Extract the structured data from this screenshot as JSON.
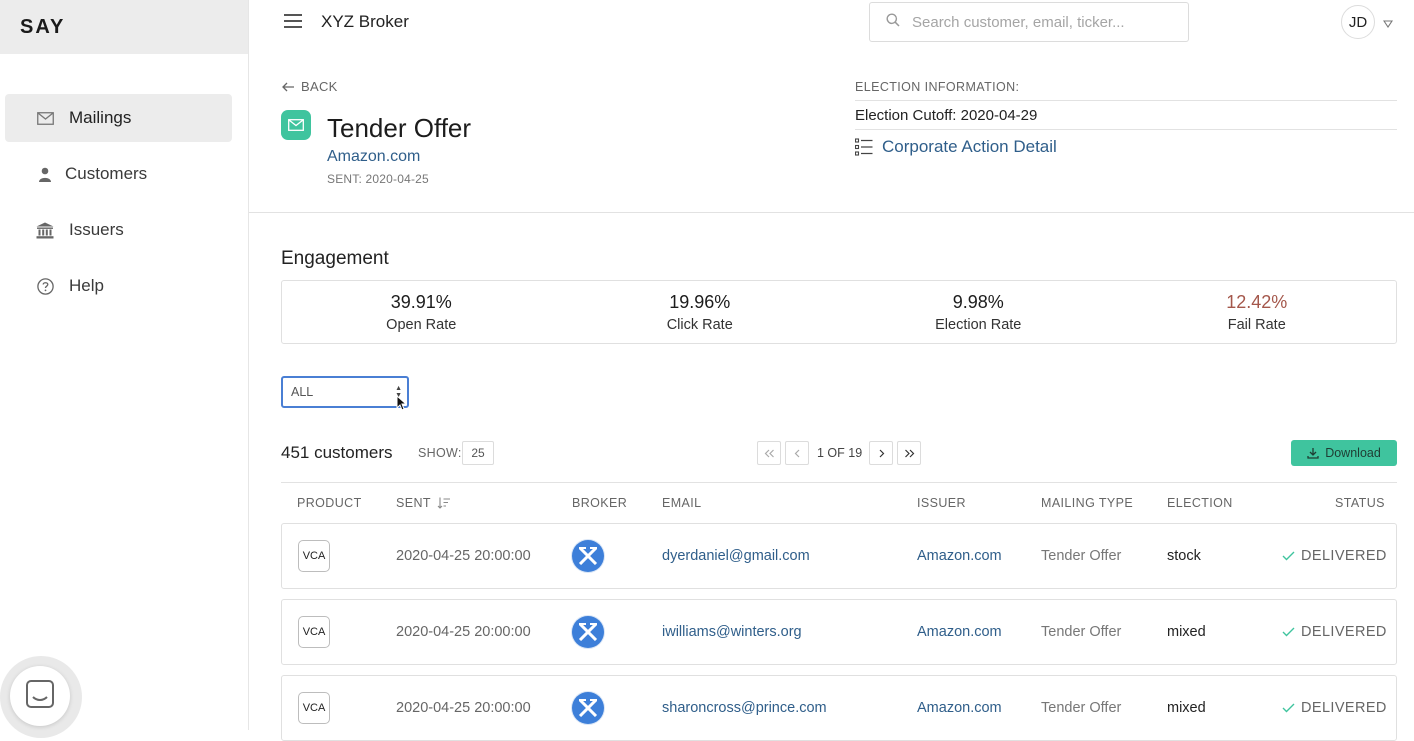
{
  "brand": {
    "logo": "SAY"
  },
  "sidebar": {
    "items": [
      {
        "label": "Mailings",
        "icon": "mail-icon",
        "active": true
      },
      {
        "label": "Customers",
        "icon": "person-icon",
        "active": false
      },
      {
        "label": "Issuers",
        "icon": "bank-icon",
        "active": false
      },
      {
        "label": "Help",
        "icon": "help-icon",
        "active": false
      }
    ]
  },
  "topbar": {
    "title": "XYZ Broker",
    "search_placeholder": "Search customer, email, ticker...",
    "user_initials": "JD"
  },
  "header": {
    "back_label": "BACK",
    "title": "Tender Offer",
    "issuer": "Amazon.com",
    "sent": "SENT: 2020-04-25"
  },
  "election": {
    "heading": "ELECTION INFORMATION:",
    "cutoff": "Election Cutoff: 2020-04-29",
    "detail_link": "Corporate Action Detail"
  },
  "engagement": {
    "title": "Engagement",
    "metrics": [
      {
        "value": "39.91%",
        "label": "Open Rate"
      },
      {
        "value": "19.96%",
        "label": "Click Rate"
      },
      {
        "value": "9.98%",
        "label": "Election Rate"
      },
      {
        "value": "12.42%",
        "label": "Fail Rate"
      }
    ],
    "fail_color": "#a4574b"
  },
  "filter": {
    "selected": "ALL"
  },
  "toolbar": {
    "count": "451 customers",
    "show_label": "SHOW:",
    "show_value": "25",
    "page_text": "1 OF 19",
    "download_label": "Download",
    "accent": "#3fc49e"
  },
  "table": {
    "columns": [
      "PRODUCT",
      "SENT",
      "BROKER",
      "EMAIL",
      "ISSUER",
      "MAILING TYPE",
      "ELECTION",
      "STATUS"
    ],
    "rows": [
      {
        "product": "VCA",
        "sent": "2020-04-25 20:00:00",
        "email": "dyerdaniel@gmail.com",
        "issuer": "Amazon.com",
        "mailing_type": "Tender Offer",
        "election": "stock",
        "status": "DELIVERED"
      },
      {
        "product": "VCA",
        "sent": "2020-04-25 20:00:00",
        "email": "iwilliams@winters.org",
        "issuer": "Amazon.com",
        "mailing_type": "Tender Offer",
        "election": "mixed",
        "status": "DELIVERED"
      },
      {
        "product": "VCA",
        "sent": "2020-04-25 20:00:00",
        "email": "sharoncross@prince.com",
        "issuer": "Amazon.com",
        "mailing_type": "Tender Offer",
        "election": "mixed",
        "status": "DELIVERED"
      }
    ]
  }
}
